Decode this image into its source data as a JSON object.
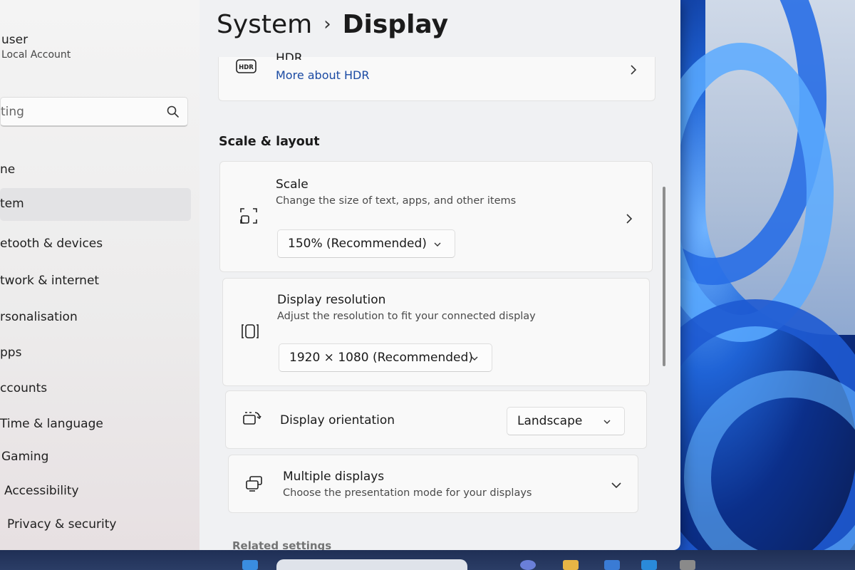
{
  "user": {
    "name": "user",
    "account_type": "Local Account"
  },
  "search": {
    "value": "ting"
  },
  "nav": {
    "items": [
      {
        "label": "ne"
      },
      {
        "label": "tem"
      },
      {
        "label": "etooth & devices"
      },
      {
        "label": "twork & internet"
      },
      {
        "label": "rsonalisation"
      },
      {
        "label": "pps"
      },
      {
        "label": "ccounts"
      },
      {
        "label": "Time & language"
      },
      {
        "label": "Gaming"
      },
      {
        "label": "Accessibility"
      },
      {
        "label": "Privacy & security"
      }
    ],
    "selected_index": 1
  },
  "breadcrumb": {
    "parent": "System",
    "separator": "›",
    "current": "Display"
  },
  "hdr": {
    "icon_text": "HDR",
    "title": "HDR",
    "link": "More about HDR"
  },
  "section": {
    "heading": "Scale & layout"
  },
  "scale": {
    "title": "Scale",
    "subtitle": "Change the size of text, apps, and other items",
    "value": "150% (Recommended)"
  },
  "resolution": {
    "title": "Display resolution",
    "subtitle": "Adjust the resolution to fit your connected display",
    "value": "1920 × 1080 (Recommended)"
  },
  "orientation": {
    "title": "Display orientation",
    "value": "Landscape"
  },
  "multiple": {
    "title": "Multiple displays",
    "subtitle": "Choose the presentation mode for your displays"
  },
  "related": {
    "heading": "Related settings"
  },
  "colors": {
    "accent_link": "#1a4aa3",
    "selected_nav": "#e3e3e5",
    "wallpaper": "#1f63d6"
  }
}
